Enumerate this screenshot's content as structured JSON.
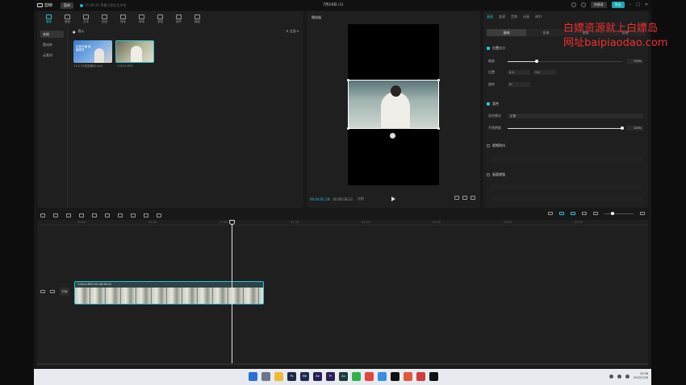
{
  "titlebar": {
    "app_name": "剪映",
    "menu_label": "菜单",
    "autosave_text": "15:08:30 草稿已保存至本地",
    "title": "7月18日 (1)",
    "shortcut_label": "快捷键",
    "export_label": "导出"
  },
  "media": {
    "tabs": [
      {
        "label": "媒体",
        "icon": "media-icon"
      },
      {
        "label": "音频",
        "icon": "audio-icon"
      },
      {
        "label": "文本",
        "icon": "text-icon"
      },
      {
        "label": "贴纸",
        "icon": "sticker-icon"
      },
      {
        "label": "特效",
        "icon": "effects-icon"
      },
      {
        "label": "转场",
        "icon": "transition-icon"
      },
      {
        "label": "滤镜",
        "icon": "filter-icon"
      },
      {
        "label": "调节",
        "icon": "adjust-icon"
      },
      {
        "label": "模板",
        "icon": "template-icon"
      }
    ],
    "sidebar": [
      "本地",
      "素材库",
      "云素材"
    ],
    "import_label": "导入",
    "sort_label": "全部",
    "clips": [
      {
        "name": "1107 抖音直播间.mp4",
        "thumb_text": "抖音开播 直播带货"
      },
      {
        "name": "C0014.MP4"
      }
    ]
  },
  "player": {
    "title": "播放器",
    "current_time": "00:04:01:18",
    "total_time": "00:06:58:23",
    "mode": "比例"
  },
  "inspector": {
    "tabs": [
      "画面",
      "变速",
      "音频",
      "动画",
      "调节"
    ],
    "subtabs": [
      "基础",
      "抠像",
      "蒙版",
      "背景"
    ],
    "sections": {
      "position": {
        "title": "位置大小",
        "scale_label": "缩放",
        "scale_value": "100%",
        "scale_percent": 25,
        "pos_label": "位置",
        "x_label": "X",
        "x_value": "0",
        "y_label": "Y",
        "y_value": "0",
        "rotate_label": "旋转",
        "rotate_value": "0°"
      },
      "blend": {
        "title": "混合",
        "mode_label": "混合模式",
        "mode_value": "正常",
        "opacity_label": "不透明度",
        "opacity_value": "100%",
        "opacity_percent": 100
      },
      "stabilize": {
        "title": "视频防抖"
      },
      "enhance": {
        "title": "画面增强"
      }
    }
  },
  "watermark": {
    "line1": "白嫖资源就上白嫖岛",
    "line2": "网址baipiaodao.com"
  },
  "timeline": {
    "ticks": [
      "00:00",
      "00:30",
      "01:00",
      "01:30",
      "02:00",
      "02:30",
      "03:00",
      "03:30"
    ],
    "cover_label": "封面",
    "clip_label": "C0014.MP4  00:06:58:22"
  },
  "taskbar": {
    "apps": [
      {
        "icon": "windows-icon",
        "color": "#2b6fd6"
      },
      {
        "icon": "search-icon",
        "color": "#6b7788"
      },
      {
        "icon": "files-icon",
        "color": "#f0b93a"
      },
      {
        "icon": "photoshop-icon",
        "color": "#1b2a4a",
        "label": "Ps"
      },
      {
        "icon": "media-encoder-icon",
        "color": "#1e2a55",
        "label": "Me"
      },
      {
        "icon": "after-effects-icon",
        "color": "#2a1f55",
        "label": "Ae"
      },
      {
        "icon": "premiere-icon",
        "color": "#2a1f55",
        "label": "Pr"
      },
      {
        "icon": "audition-icon",
        "color": "#1c3a3a",
        "label": "Au"
      },
      {
        "icon": "wechat-icon",
        "color": "#2fb24c"
      },
      {
        "icon": "chrome-icon",
        "color": "#e0463a"
      },
      {
        "icon": "app-icon",
        "color": "#3a8de0"
      },
      {
        "icon": "tiktok-icon",
        "color": "#111111"
      },
      {
        "icon": "app-icon",
        "color": "#e05a3a"
      },
      {
        "icon": "app-icon",
        "color": "#d23b3b"
      },
      {
        "icon": "capcut-icon",
        "color": "#111111"
      }
    ],
    "time": "15:08",
    "date": "2022/7/18"
  }
}
